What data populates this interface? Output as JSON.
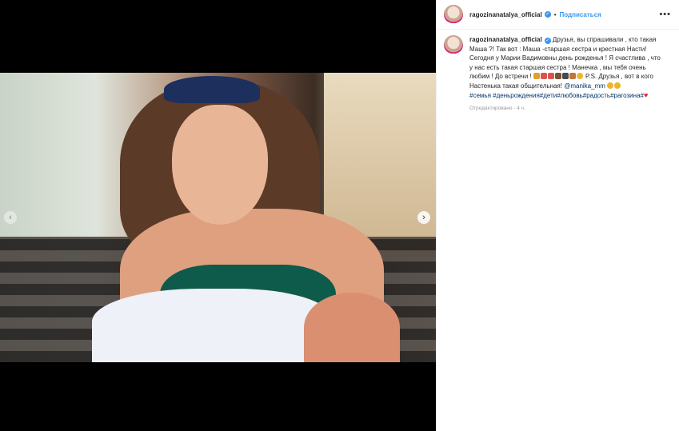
{
  "post": {
    "username": "ragozinanatalya_official",
    "follow_label": "Подписаться",
    "separator": "•",
    "more_label": "•••",
    "verified_glyph": "✓"
  },
  "media": {
    "prev_glyph": "‹",
    "next_glyph": "›"
  },
  "caption": {
    "username": "ragozinanatalya_official",
    "text_part1": " Друзья, вы спрашивали , кто такая Маша ?! Так вот : Маша -старшая сестра и крестная Насти! Сегодня у Марии Вадимовны день рожденья ! Я счастлива , что у нас есть такая старшая сестра ! Манечка , мы тебя очень любим ! До встречи ! ",
    "text_part2": " P.S. Друзья , вот в кого Настенька такая общительная! ",
    "mention": "@manika_mm",
    "hashtags": "#семья #деньрождения#дети#любовь#радость#рагозина#",
    "heart": "♥",
    "edited": "Отредактировано · 4 ч."
  }
}
